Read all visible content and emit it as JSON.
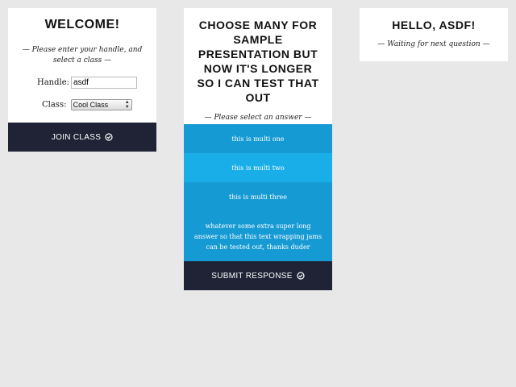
{
  "welcome_card": {
    "title": "WELCOME!",
    "subtitle": "— Please enter your handle, and select a class —",
    "handle_label": "Handle:",
    "handle_value": "asdf",
    "class_label": "Class:",
    "class_selected": "Cool Class",
    "join_label": "JOIN CLASS",
    "join_icon": "check-circle-icon"
  },
  "question_card": {
    "title": "CHOOSE MANY FOR SAMPLE PRESENTATION BUT NOW IT'S LONGER SO I CAN TEST THAT OUT",
    "subtitle": "— Please select an answer —",
    "answers": [
      {
        "label": "this is multi one",
        "color": "#169ad4"
      },
      {
        "label": "this is multi two",
        "color": "#1aaee8"
      },
      {
        "label": "this is multi three",
        "color": "#169ad4"
      },
      {
        "label": "whatever some extra super long answer so that this text wrapping jams can be tested out, thanks duder",
        "color": "#169ad4"
      }
    ],
    "submit_label": "SUBMIT RESPONSE",
    "submit_icon": "check-circle-icon"
  },
  "hello_card": {
    "title": "HELLO, ASDF!",
    "subtitle": "— Waiting for next question —"
  },
  "colors": {
    "background": "#e8e8e8",
    "card": "#ffffff",
    "dark_button": "#1f2335",
    "answer_blue": "#169ad4",
    "answer_blue_selected": "#1aaee8"
  }
}
